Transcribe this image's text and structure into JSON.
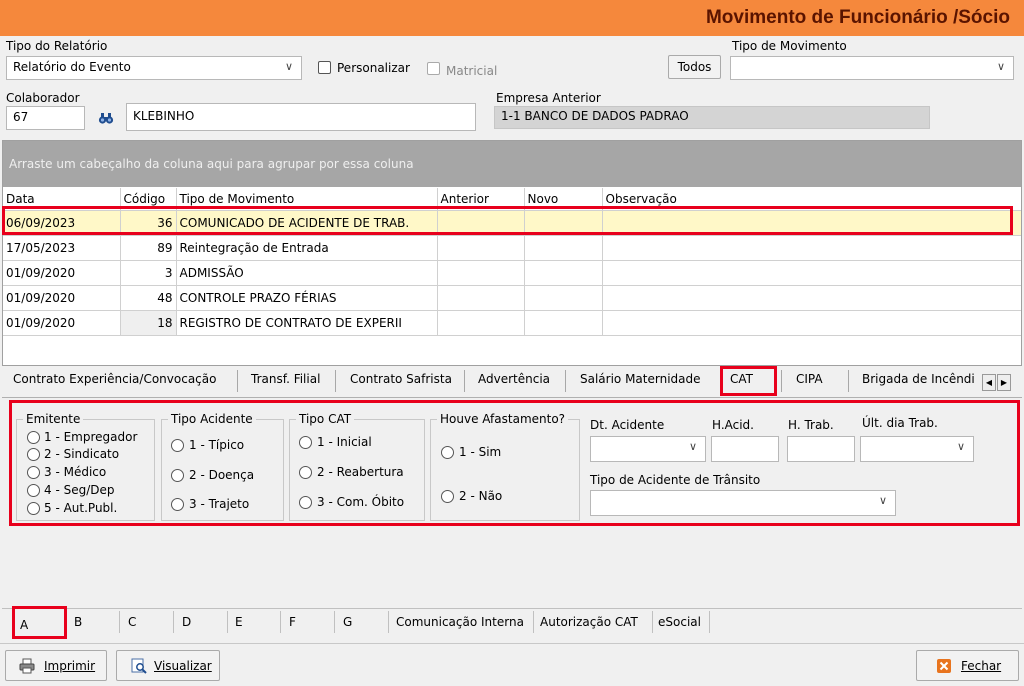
{
  "window": {
    "title": "Movimento de Funcionário /Sócio"
  },
  "report": {
    "tipo_relatorio_label": "Tipo do Relatório",
    "tipo_relatorio_value": "Relatório do Evento",
    "personalizar_label": "Personalizar",
    "matricial_label": "Matricial",
    "todos_label": "Todos",
    "tipo_movimento_label": "Tipo de Movimento",
    "tipo_movimento_value": ""
  },
  "colaborador": {
    "label": "Colaborador",
    "code": "67",
    "name": "KLEBINHO",
    "empresa_label": "Empresa Anterior",
    "empresa_value": "1-1  BANCO DE DADOS PADRAO"
  },
  "grid": {
    "group_hint": "Arraste um cabeçalho da coluna aqui para agrupar por essa coluna",
    "columns": [
      "Data",
      "Código",
      "Tipo de Movimento",
      "Anterior",
      "Novo",
      "Observação"
    ],
    "rows": [
      {
        "data": "06/09/2023",
        "codigo": "36",
        "tipo": "COMUNICADO DE ACIDENTE DE TRAB.",
        "anterior": "",
        "novo": "",
        "obs": ""
      },
      {
        "data": "17/05/2023",
        "codigo": "89",
        "tipo": "Reintegração de Entrada",
        "anterior": "",
        "novo": "",
        "obs": ""
      },
      {
        "data": "01/09/2020",
        "codigo": "3",
        "tipo": "ADMISSÃO",
        "anterior": "",
        "novo": "",
        "obs": ""
      },
      {
        "data": "01/09/2020",
        "codigo": "48",
        "tipo": "CONTROLE PRAZO FÉRIAS",
        "anterior": "",
        "novo": "",
        "obs": ""
      },
      {
        "data": "01/09/2020",
        "codigo": "18",
        "tipo": "REGISTRO DE CONTRATO DE EXPERII",
        "anterior": "",
        "novo": "",
        "obs": ""
      }
    ]
  },
  "tabs": [
    "Contrato Experiência/Convocação",
    "Transf. Filial",
    "Contrato Safrista",
    "Advertência",
    "Salário Maternidade",
    "CAT",
    "CIPA",
    "Brigada de Incêndi"
  ],
  "cat": {
    "emitente": {
      "title": "Emitente",
      "options": [
        "1 - Empregador",
        "2 - Sindicato",
        "3 - Médico",
        "4 - Seg/Dep",
        "5 - Aut.Publ."
      ]
    },
    "tipo_acidente": {
      "title": "Tipo Acidente",
      "options": [
        "1 - Típico",
        "2 - Doença",
        "3 - Trajeto"
      ]
    },
    "tipo_cat": {
      "title": "Tipo CAT",
      "options": [
        "1 - Inicial",
        "2 - Reabertura",
        "3 - Com. Óbito"
      ]
    },
    "afastamento": {
      "title": "Houve Afastamento?",
      "options": [
        "1 - Sim",
        "2 - Não"
      ]
    },
    "dt_acidente_label": "Dt. Acidente",
    "h_acid_label": "H.Acid.",
    "h_trab_label": "H. Trab.",
    "ult_dia_label": "Últ. dia Trab.",
    "tipo_transito_label": "Tipo de Acidente de Trânsito"
  },
  "bottom_tabs": [
    "A",
    "B",
    "C",
    "D",
    "E",
    "F",
    "G",
    "Comunicação Interna",
    "Autorização CAT",
    "eSocial"
  ],
  "footer": {
    "imprimir": "Imprimir",
    "visualizar": "Visualizar",
    "fechar": "Fechar"
  }
}
